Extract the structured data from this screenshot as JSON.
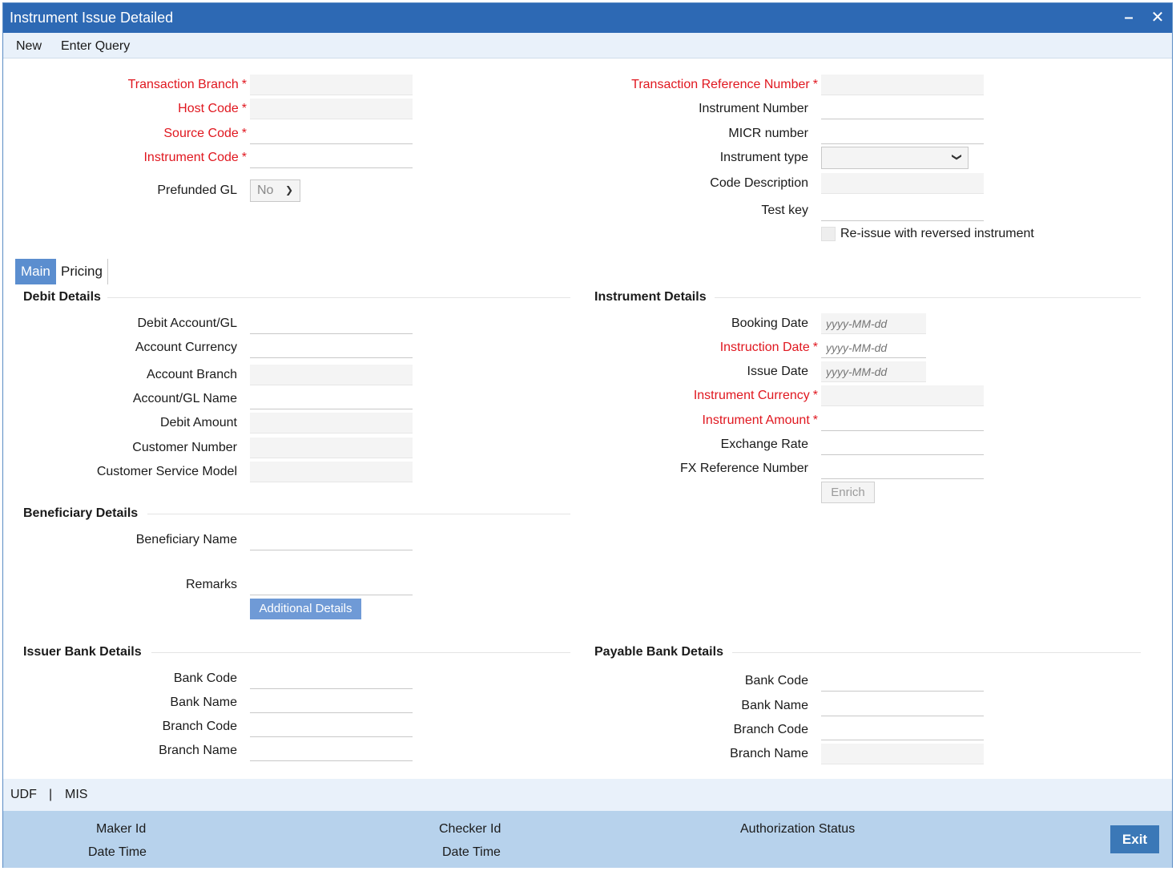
{
  "window": {
    "title": "Instrument Issue Detailed",
    "minimize_glyph": "–",
    "close_glyph": "✕"
  },
  "toolbar": {
    "new_label": "New",
    "enter_query_label": "Enter Query"
  },
  "header_left": {
    "transaction_branch": "Transaction Branch",
    "host_code": "Host Code",
    "source_code": "Source Code",
    "instrument_code": "Instrument Code",
    "prefunded_gl": "Prefunded GL",
    "prefunded_gl_value": "No",
    "required_mark": "*"
  },
  "header_right": {
    "transaction_reference_number": "Transaction Reference Number",
    "instrument_number": "Instrument Number",
    "micr_number": "MICR number",
    "instrument_type": "Instrument type",
    "instrument_type_value": "",
    "code_description": "Code Description",
    "test_key": "Test key",
    "reissue_label": "Re-issue with reversed instrument"
  },
  "tabs": {
    "main": "Main",
    "pricing": "Pricing"
  },
  "debit_details": {
    "title": "Debit Details",
    "debit_account_gl": "Debit Account/GL",
    "account_currency": "Account Currency",
    "account_branch": "Account Branch",
    "account_gl_name": "Account/GL Name",
    "debit_amount": "Debit Amount",
    "customer_number": "Customer Number",
    "customer_service_model": "Customer Service Model"
  },
  "instrument_details": {
    "title": "Instrument Details",
    "booking_date": "Booking Date",
    "instruction_date": "Instruction Date",
    "issue_date": "Issue Date",
    "instrument_currency": "Instrument Currency",
    "instrument_amount": "Instrument Amount",
    "exchange_rate": "Exchange Rate",
    "fx_reference_number": "FX Reference Number",
    "date_placeholder": "yyyy-MM-dd",
    "enrich_label": "Enrich"
  },
  "beneficiary_details": {
    "title": "Beneficiary Details",
    "beneficiary_name": "Beneficiary Name",
    "remarks": "Remarks",
    "additional_details_label": "Additional Details"
  },
  "issuer_bank": {
    "title": "Issuer Bank Details",
    "bank_code": "Bank Code",
    "bank_name": "Bank Name",
    "branch_code": "Branch Code",
    "branch_name": "Branch Name"
  },
  "payable_bank": {
    "title": "Payable Bank Details",
    "bank_code": "Bank Code",
    "bank_name": "Bank Name",
    "branch_code": "Branch Code",
    "branch_name": "Branch Name"
  },
  "udf_bar": {
    "udf": "UDF",
    "separator": "|",
    "mis": "MIS"
  },
  "footer": {
    "maker_id": "Maker Id",
    "maker_date_time": "Date Time",
    "checker_id": "Checker Id",
    "checker_date_time": "Date Time",
    "authorization_status": "Authorization Status",
    "exit_label": "Exit"
  },
  "colors": {
    "title_bar": "#2d69b4",
    "required": "#e0171f",
    "tab_active": "#5b8ecf",
    "footer": "#b7d2ec",
    "exit": "#3b78b7"
  }
}
